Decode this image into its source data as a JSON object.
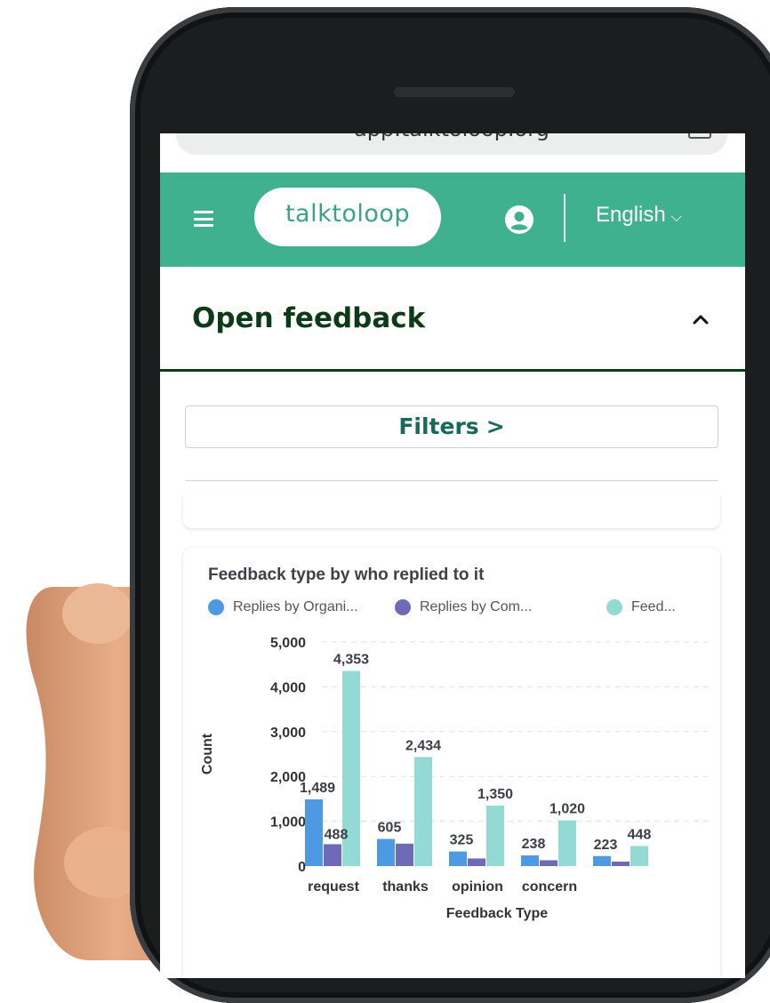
{
  "browser": {
    "url": "app.talktoloop.org"
  },
  "header": {
    "logo_text": "talktoloop",
    "language": "English",
    "accent_color": "#40b18f"
  },
  "section": {
    "title": "Open feedback"
  },
  "filters": {
    "label": "Filters"
  },
  "chart_card": {
    "title": "Feedback type by who replied to it",
    "legend": [
      {
        "label": "Replies by Organi...",
        "color": "#4d9ae2"
      },
      {
        "label": "Replies by Com...",
        "color": "#6e6ab8"
      },
      {
        "label": "Feed...",
        "color": "#93dad5"
      }
    ]
  },
  "chart_data": {
    "type": "bar",
    "categories": [
      "request",
      "thanks",
      "opinion",
      "concern",
      ""
    ],
    "series": [
      {
        "name": "Replies by Organi...",
        "color": "#4d9ae2",
        "values": [
          1489,
          605,
          325,
          238,
          223
        ]
      },
      {
        "name": "Replies by Com...",
        "color": "#6e6ab8",
        "values": [
          488,
          500,
          170,
          130,
          100
        ]
      },
      {
        "name": "Feed...",
        "color": "#93dad5",
        "values": [
          4353,
          2434,
          1350,
          1020,
          448
        ]
      }
    ],
    "data_labels": [
      {
        "series": 0,
        "index": 0,
        "text": "1,489"
      },
      {
        "series": 1,
        "index": 0,
        "text": "488"
      },
      {
        "series": 2,
        "index": 0,
        "text": "4,353"
      },
      {
        "series": 0,
        "index": 1,
        "text": "605"
      },
      {
        "series": 2,
        "index": 1,
        "text": "2,434"
      },
      {
        "series": 0,
        "index": 2,
        "text": "325"
      },
      {
        "series": 2,
        "index": 2,
        "text": "1,350"
      },
      {
        "series": 0,
        "index": 3,
        "text": "238"
      },
      {
        "series": 2,
        "index": 3,
        "text": "1,020"
      },
      {
        "series": 0,
        "index": 4,
        "text": "223"
      },
      {
        "series": 2,
        "index": 4,
        "text": "448"
      }
    ],
    "yticks": [
      "0",
      "1,000",
      "2,000",
      "3,000",
      "4,000",
      "5,000"
    ],
    "ylabel": "Count",
    "xlabel": "Feedback Type",
    "ylim": [
      0,
      5000
    ],
    "grid": true
  }
}
